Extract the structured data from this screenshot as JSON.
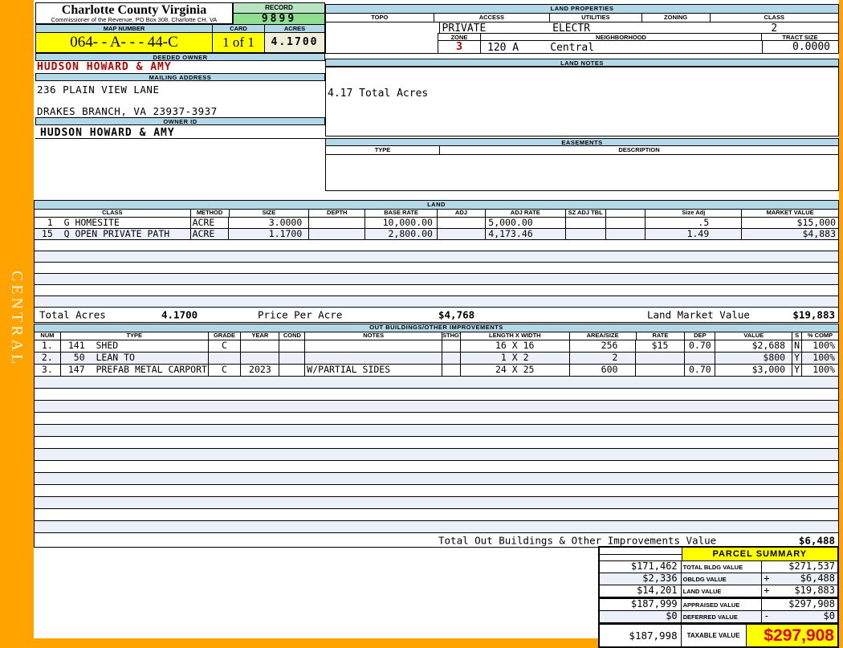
{
  "sidebar": {
    "district": "CENTRAL"
  },
  "colors": {
    "orange": "#FFA300",
    "hdrblue": "#B3D8E8",
    "yellow": "#FFFF00",
    "record_green": "#90DE90",
    "record_green_light": "#B9E4C4",
    "cream": "#F0EFDA",
    "band": "#ECF1F9",
    "red": "#C00000",
    "big_red": "#E80000"
  },
  "header": {
    "county": "Charlotte County Virginia",
    "commissioner": "Commissioner of the Revenue, PO Box 308, Charlotte CH, VA",
    "record_label": "RECORD",
    "record_value": "9899",
    "map_number_label": "MAP NUMBER",
    "map_number": "064-  - A-  -   - 44-C",
    "card_label": "CARD",
    "card_value": "1 of 1",
    "acres_label": "ACRES",
    "acres_value": "4.1700"
  },
  "owner": {
    "deeded_owner_label": "DEEDED OWNER",
    "deeded_owner": "HUDSON HOWARD & AMY",
    "mailing_address_label": "MAILING ADDRESS",
    "address_line1": "236 PLAIN VIEW LANE",
    "address_line2": "DRAKES BRANCH, VA 23937-3937",
    "owner_id_label": "OWNER ID",
    "owner_id": "HUDSON HOWARD & AMY"
  },
  "land_properties": {
    "title": "LAND PROPERTIES",
    "headers": [
      "TOPO",
      "ACCESS",
      "UTILITIES",
      "ZONING",
      "CLASS"
    ],
    "topo": "",
    "access": "PRIVATE",
    "utilities": "ELECTR",
    "zoning": "",
    "class": "2",
    "zone_label": "ZONE",
    "zone": "3",
    "neighborhood_label": "NEIGHBORHOOD",
    "neighborhood": "120 A     Central",
    "tract_size_label": "TRACT SIZE",
    "tract_size": "0.0000"
  },
  "land_notes": {
    "title": "LAND NOTES",
    "note": "4.17 Total Acres"
  },
  "easements": {
    "title": "EASEMENTS",
    "type_label": "TYPE",
    "description_label": "DESCRIPTION"
  },
  "land": {
    "title": "LAND",
    "headers": [
      "CLASS",
      "METHOD",
      "SIZE",
      "DEPTH",
      "BASE RATE",
      "ADJ",
      "ADJ RATE",
      "SZ ADJ TBL",
      "",
      "Size Adj",
      "MARKET VALUE"
    ],
    "rows": [
      {
        "class": "  1  G HOMESITE",
        "method": "ACRE",
        "size": "3.0000",
        "depth": "",
        "base_rate": "10,000.00",
        "adj": "",
        "adj_rate": "5,000.00",
        "sz_adj_tbl": "",
        "blank": "",
        "size_adj": ".5",
        "market_value": "$15,000"
      },
      {
        "class": " 15  Q OPEN PRIVATE PATH",
        "method": "ACRE",
        "size": "1.1700",
        "depth": "",
        "base_rate": "2,800.00",
        "adj": "",
        "adj_rate": "4,173.46",
        "sz_adj_tbl": "",
        "blank": "",
        "size_adj": "1.49",
        "market_value": "$4,883"
      }
    ],
    "empty_rows": 6,
    "totals": {
      "total_acres_label": "Total Acres",
      "total_acres": "4.1700",
      "price_per_acre_label": "Price Per Acre",
      "price_per_acre": "$4,768",
      "land_market_value_label": "Land Market Value",
      "land_market_value": "$19,883"
    }
  },
  "outbuildings": {
    "title": "OUT BUILDINGS/OTHER IMPROVEMENTS",
    "headers": [
      "NUM",
      "TYPE",
      "GRADE",
      "YEAR",
      "COND",
      "NOTES",
      "STHGT",
      "LENGTH X WIDTH",
      "AREA/SIZE",
      "RATE",
      "DEP",
      "VALUE",
      "S",
      "% COMP"
    ],
    "rows": [
      {
        "num": " 1.",
        "type": " 141  SHED",
        "grade": "C",
        "year": "",
        "cond": "",
        "notes": "",
        "sthgt": "",
        "lxw": "16 X 16",
        "area": "256",
        "rate": "$15",
        "dep": "0.70",
        "value": "$2,688",
        "s": "N",
        "comp": "100%"
      },
      {
        "num": " 2.",
        "type": "  50  LEAN TO",
        "grade": "",
        "year": "",
        "cond": "",
        "notes": "",
        "sthgt": "",
        "lxw": "1 X 2",
        "area": "2",
        "rate": "",
        "dep": "",
        "value": "$800",
        "s": "Y",
        "comp": "100%"
      },
      {
        "num": " 3.",
        "type": " 147  PREFAB METAL CARPORT",
        "grade": "C",
        "year": "2023",
        "cond": "",
        "notes": "W/PARTIAL SIDES",
        "sthgt": "",
        "lxw": "24 X 25",
        "area": "600",
        "rate": "",
        "dep": "0.70",
        "value": "$3,000",
        "s": "Y",
        "comp": "100%"
      }
    ],
    "empty_rows": 13,
    "total_label": "Total Out Buildings & Other Improvements Value",
    "total_value": "$6,488"
  },
  "parcel_summary": {
    "title": "PARCEL SUMMARY",
    "rows": [
      {
        "prior": "$171,462",
        "label": "TOTAL BLDG VALUE",
        "op": "",
        "value": "$271,537",
        "shade": false
      },
      {
        "prior": "$2,336",
        "label": "OBLDG VALUE",
        "op": "+",
        "value": "$6,488",
        "shade": true
      },
      {
        "prior": "$14,201",
        "label": "LAND VALUE",
        "op": "+",
        "value": "$19,883",
        "shade": false
      },
      {
        "prior": "$187,999",
        "label": "APPRAISED VALUE",
        "op": "",
        "value": "$297,908",
        "shade": false
      },
      {
        "prior": "$0",
        "label": "DEFERRED VALUE",
        "op": "-",
        "value": "$0",
        "shade": true
      }
    ],
    "taxable": {
      "prior": "$187,998",
      "label": "TAXABLE VALUE",
      "value": "$297,908"
    }
  }
}
